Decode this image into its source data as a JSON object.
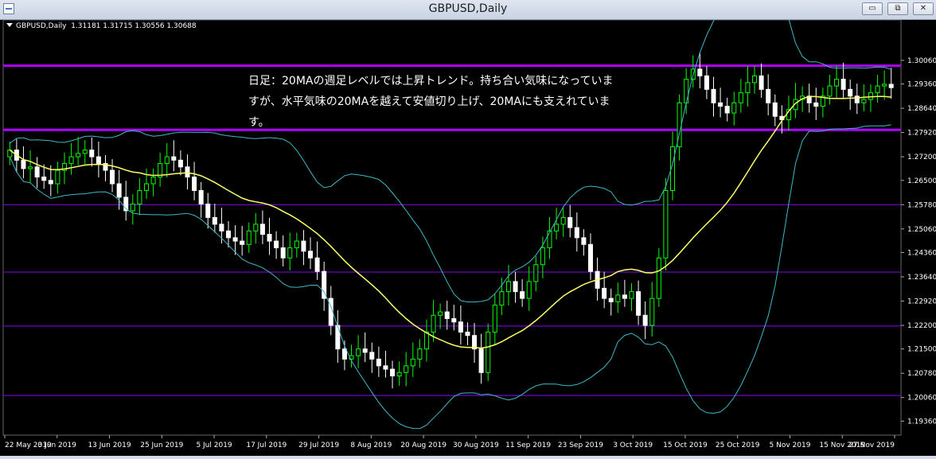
{
  "window": {
    "title": "GBPUSD,Daily",
    "minimize": "▭",
    "restore": "⧉",
    "close": "✕"
  },
  "info": {
    "symbol": "GBPUSD,Daily",
    "ohlc": "1.31181 1.31715 1.30556 1.30688"
  },
  "annotation": "日足：20MAの週足レベルでは上昇トレンド。持ち合い気味になっていますが、水平気味の20MAを越えて安値切り上げ、20MAにも支えれています。",
  "colors": {
    "bull": "#00ff00",
    "bear": "#ffffff",
    "ma": "#ffff66",
    "bollinger": "#3fb8c8",
    "hline": "#8a00ff",
    "hline_major": "#b000ff",
    "mark_yellow": "#ffff00",
    "mark_pink": "#ffb6e6"
  },
  "chart_data": {
    "type": "candlestick",
    "title": "GBPUSD,Daily",
    "y_ticks": [
      "1.30060",
      "1.29360",
      "1.28640",
      "1.27920",
      "1.27200",
      "1.26500",
      "1.25780",
      "1.25060",
      "1.24360",
      "1.23640",
      "1.22920",
      "1.22200",
      "1.21500",
      "1.20780",
      "1.20060",
      "1.19360"
    ],
    "ylim": [
      1.1918,
      1.306
    ],
    "x_ticks": [
      "22 May 2019",
      "3 Jun 2019",
      "13 Jun 2019",
      "25 Jun 2019",
      "5 Jul 2019",
      "17 Jul 2019",
      "29 Jul 2019",
      "8 Aug 2019",
      "20 Aug 2019",
      "30 Aug 2019",
      "11 Sep 2019",
      "23 Sep 2019",
      "3 Oct 2019",
      "15 Oct 2019",
      "25 Oct 2019",
      "5 Nov 2019",
      "15 Nov 2019",
      "27 Nov 2019"
    ],
    "horizontal_levels": [
      {
        "price": 1.299,
        "style": "major"
      },
      {
        "price": 1.28,
        "style": "major"
      },
      {
        "price": 1.2578,
        "style": "minor"
      },
      {
        "price": 1.2378,
        "style": "minor"
      },
      {
        "price": 1.2218,
        "style": "minor"
      },
      {
        "price": 1.2012,
        "style": "minor"
      }
    ],
    "closes": [
      1.274,
      1.271,
      1.2685,
      1.269,
      1.266,
      1.265,
      1.264,
      1.268,
      1.27,
      1.272,
      1.273,
      1.274,
      1.272,
      1.27,
      1.268,
      1.264,
      1.26,
      1.256,
      1.258,
      1.262,
      1.264,
      1.266,
      1.27,
      1.272,
      1.271,
      1.269,
      1.266,
      1.262,
      1.258,
      1.254,
      1.252,
      1.25,
      1.248,
      1.247,
      1.246,
      1.25,
      1.252,
      1.249,
      1.247,
      1.245,
      1.242,
      1.245,
      1.247,
      1.244,
      1.242,
      1.238,
      1.23,
      1.222,
      1.215,
      1.212,
      1.213,
      1.215,
      1.214,
      1.212,
      1.21,
      1.209,
      1.207,
      1.208,
      1.21,
      1.212,
      1.215,
      1.22,
      1.225,
      1.226,
      1.224,
      1.223,
      1.22,
      1.219,
      1.215,
      1.208,
      1.22,
      1.228,
      1.232,
      1.235,
      1.232,
      1.23,
      1.235,
      1.24,
      1.245,
      1.25,
      1.252,
      1.254,
      1.251,
      1.248,
      1.246,
      1.238,
      1.233,
      1.23,
      1.229,
      1.231,
      1.23,
      1.232,
      1.225,
      1.222,
      1.23,
      1.242,
      1.262,
      1.275,
      1.288,
      1.295,
      1.298,
      1.296,
      1.292,
      1.288,
      1.287,
      1.285,
      1.288,
      1.291,
      1.294,
      1.296,
      1.292,
      1.288,
      1.284,
      1.283,
      1.286,
      1.289,
      1.29,
      1.288,
      1.287,
      1.29,
      1.293,
      1.295,
      1.292,
      1.29,
      1.288,
      1.289,
      1.291,
      1.293,
      1.2935,
      1.2925
    ]
  }
}
